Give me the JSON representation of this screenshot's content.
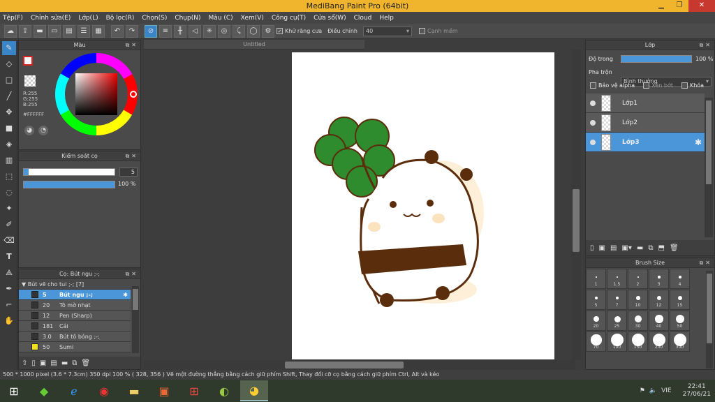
{
  "window": {
    "title": "MediBang Paint Pro (64bit)"
  },
  "menu": [
    "Tệp(F)",
    "Chỉnh sửa(E)",
    "Lớp(L)",
    "Bộ lọc(R)",
    "Chọn(S)",
    "Chụp(N)",
    "Màu (C)",
    "Xem(V)",
    "Công cụ(T)",
    "Cửa sổ(W)",
    "Cloud",
    "Help"
  ],
  "toolbar": {
    "antialias_label": "Khử răng cưa",
    "adjust_label": "Điều chỉnh",
    "adjust_value": "40",
    "edge_label": "Cạnh mềm"
  },
  "color_panel": {
    "title": "Màu",
    "r": "R:255",
    "g": "G:255",
    "b": "B:255",
    "hex": "#FFFFFF"
  },
  "brush_control": {
    "title": "Kiểm soát cọ",
    "size_value": "5",
    "opacity_value": "100 %",
    "opacity": 1.0,
    "size": 0.05
  },
  "brush_panel": {
    "title": "Cọ: Bút ngu ;-;",
    "group": "Bút vẽ cho tui ;-; [7]",
    "items": [
      {
        "size": "5",
        "name": "Bút ngu ;-;",
        "selected": true
      },
      {
        "size": "20",
        "name": "Tô mờ nhạt"
      },
      {
        "size": "12",
        "name": "Pen (Sharp)"
      },
      {
        "size": "181",
        "name": "Cái"
      },
      {
        "size": "3.0",
        "name": "Bút tô bóng ;-;"
      },
      {
        "size": "50",
        "name": "Sumi"
      }
    ]
  },
  "document": {
    "tab": "Untitled"
  },
  "layer_panel": {
    "title": "Lớp",
    "opacity_label": "Độ trong",
    "opacity_value": "100 %",
    "blend_label": "Pha trộn",
    "blend_value": "Bình thường",
    "protect_alpha": "Bảo vệ alpha",
    "clipping": "Xén bớt",
    "lock": "Khóa",
    "layers": [
      {
        "name": "Lớp1",
        "selected": false
      },
      {
        "name": "Lớp2",
        "selected": false
      },
      {
        "name": "Lớp3",
        "selected": true
      }
    ]
  },
  "brush_size_panel": {
    "title": "Brush Size",
    "sizes": [
      "1",
      "1.5",
      "2",
      "3",
      "4",
      "5",
      "7",
      "10",
      "12",
      "15",
      "20",
      "25",
      "30",
      "40",
      "50",
      "70",
      "100",
      "150",
      "200",
      "300"
    ]
  },
  "status": "500 * 1000 pixel   (3.6 * 7.3cm)   350 dpi   100 %   ( 328, 356 )   Vẽ một đường thẳng bằng cách giữ phím Shift, Thay đổi cỡ cọ bằng cách giữ phím Ctrl, Alt và kéo",
  "taskbar": {
    "lang": "VIE",
    "time": "22:41",
    "date": "27/06/21"
  },
  "colors": {
    "accent": "#4a96d8",
    "title": "#f0b52d",
    "clover": "#2e8b2e",
    "ink": "#5a2d0c"
  }
}
